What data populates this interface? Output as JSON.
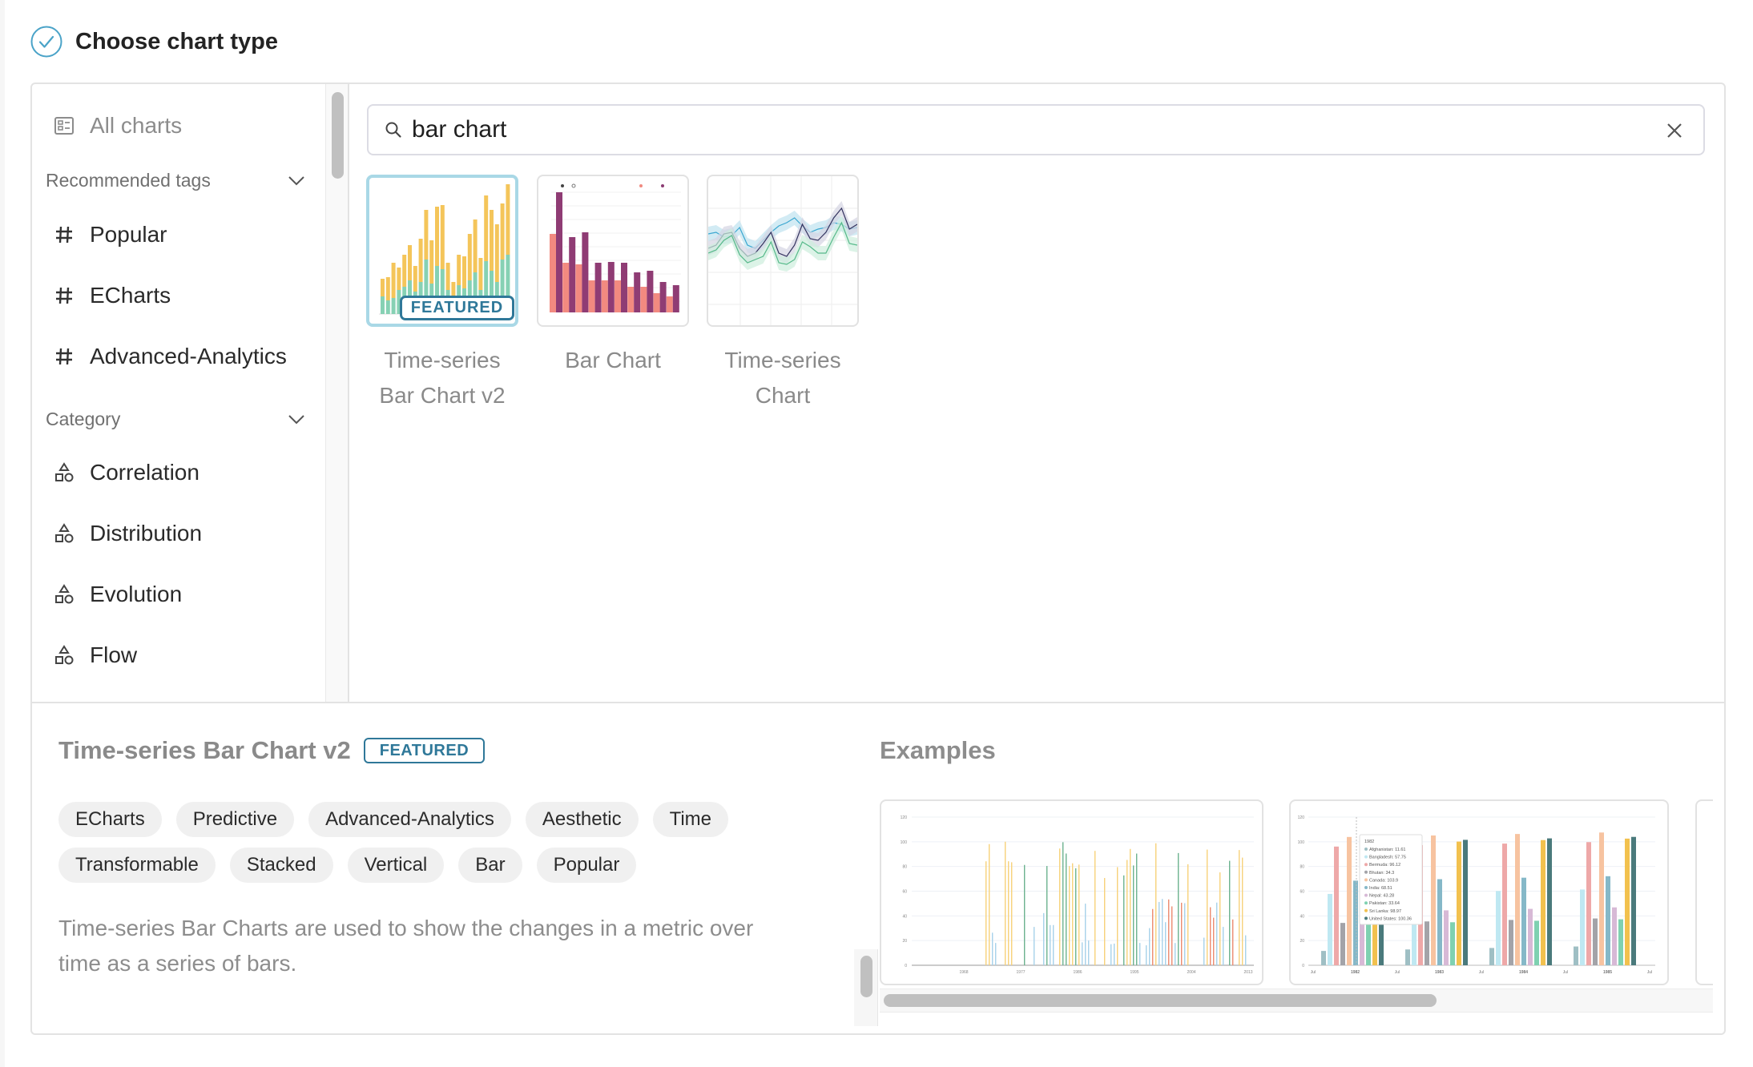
{
  "header": {
    "title": "Choose chart type",
    "icon": "check-circle-icon"
  },
  "sidebar": {
    "all_charts": {
      "label": "All charts",
      "icon": "chart-grid-icon"
    },
    "sections": [
      {
        "label": "Recommended tags",
        "expanded": true,
        "items": [
          {
            "label": "Popular",
            "icon": "hash-icon"
          },
          {
            "label": "ECharts",
            "icon": "hash-icon"
          },
          {
            "label": "Advanced-Analytics",
            "icon": "hash-icon"
          }
        ]
      },
      {
        "label": "Category",
        "expanded": true,
        "items": [
          {
            "label": "Correlation",
            "icon": "shapes-icon"
          },
          {
            "label": "Distribution",
            "icon": "shapes-icon"
          },
          {
            "label": "Evolution",
            "icon": "shapes-icon"
          },
          {
            "label": "Flow",
            "icon": "shapes-icon"
          }
        ]
      }
    ]
  },
  "search": {
    "value": "bar chart",
    "placeholder": ""
  },
  "results": [
    {
      "name_line1": "Time-series",
      "name_line2": "Bar Chart v2",
      "featured": true,
      "selected": true,
      "featured_label": "FEATURED"
    },
    {
      "name_line1": "Bar Chart",
      "name_line2": "",
      "featured": false,
      "selected": false
    },
    {
      "name_line1": "Time-series",
      "name_line2": "Chart",
      "featured": false,
      "selected": false
    }
  ],
  "detail": {
    "title": "Time-series Bar Chart v2",
    "badge": "FEATURED",
    "tags": [
      "ECharts",
      "Predictive",
      "Advanced-Analytics",
      "Aesthetic",
      "Time",
      "Transformable",
      "Stacked",
      "Vertical",
      "Bar",
      "Popular"
    ],
    "description": "Time-series Bar Charts are used to show the changes in a metric over time as a series of bars."
  },
  "examples": {
    "title": "Examples",
    "example1": {
      "y_ticks": [
        "0",
        "20",
        "40",
        "60",
        "80",
        "100",
        "120"
      ],
      "x_ticks": [
        "1968",
        "1977",
        "1986",
        "1995",
        "2004",
        "2013"
      ]
    },
    "example2": {
      "y_ticks": [
        "0",
        "20",
        "40",
        "60",
        "80",
        "100",
        "120"
      ],
      "x_ticks": [
        "Jul",
        "1982",
        "Jul",
        "1983",
        "Jul",
        "1984",
        "Jul",
        "1985",
        "Jul"
      ],
      "tooltip": {
        "title": "1982",
        "rows": [
          {
            "label": "Afghanistan: 11.61",
            "color": "#9fbfc4"
          },
          {
            "label": "Bangladesh: 57.75",
            "color": "#bfe8f2"
          },
          {
            "label": "Bermuda: 96.12",
            "color": "#eea8a8"
          },
          {
            "label": "Bhutan: 34.3",
            "color": "#a3a3a8"
          },
          {
            "label": "Canada: 103.9",
            "color": "#f7c3a0"
          },
          {
            "label": "India: 68.51",
            "color": "#85b8c8"
          },
          {
            "label": "Nepal: 43.28",
            "color": "#d7b9d6"
          },
          {
            "label": "Pakistan: 33.64",
            "color": "#7fd1b1"
          },
          {
            "label": "Sri Lanka: 98.97",
            "color": "#f2c14e"
          },
          {
            "label": "United States: 100.36",
            "color": "#4a7a7c"
          }
        ]
      }
    }
  },
  "colors": {
    "accent": "#2f7899",
    "selected_border": "#a9d8e6",
    "check": "#4aa3c8",
    "tag_bg": "#f0f0f0"
  }
}
